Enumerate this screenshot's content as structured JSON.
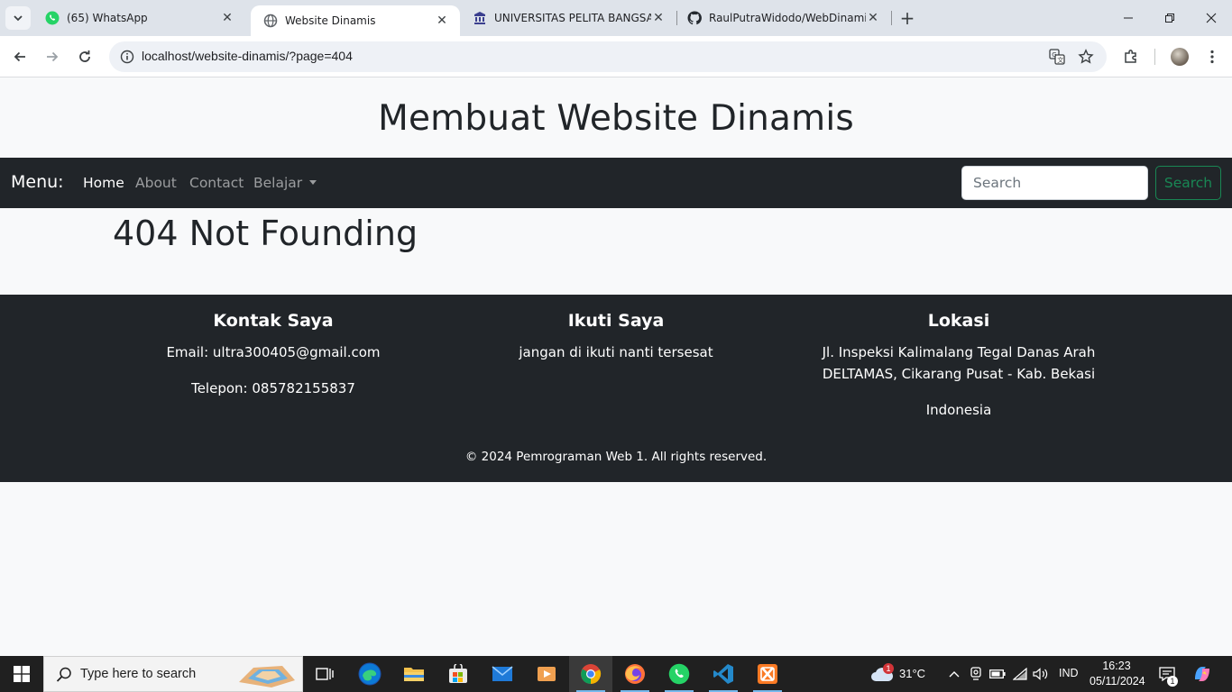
{
  "browser": {
    "tabs": [
      {
        "title": "(65) WhatsApp",
        "favicon": "whatsapp-icon"
      },
      {
        "title": "Website Dinamis",
        "favicon": "globe-icon",
        "active": true
      },
      {
        "title": "UNIVERSITAS PELITA BANGSA",
        "favicon": "university-icon"
      },
      {
        "title": "RaulPutraWidodo/WebDinamis",
        "favicon": "github-icon"
      }
    ],
    "url": "localhost/website-dinamis/?page=404"
  },
  "site": {
    "title": "Membuat Website Dinamis",
    "nav": {
      "brand": "Menu:",
      "links": [
        "Home",
        "About",
        "Contact",
        "Belajar"
      ],
      "search_placeholder": "Search",
      "search_button": "Search"
    },
    "content": {
      "heading": "404 Not Founding"
    },
    "footer": {
      "contact": {
        "heading": "Kontak Saya",
        "email": "Email: ultra300405@gmail.com",
        "phone": "Telepon: 085782155837"
      },
      "follow": {
        "heading": "Ikuti Saya",
        "text": "jangan di ikuti nanti tersesat"
      },
      "location": {
        "heading": "Lokasi",
        "address_line1": "Jl. Inspeksi Kalimalang Tegal Danas Arah",
        "address_line2": "DELTAMAS, Cikarang Pusat - Kab. Bekasi",
        "country": "Indonesia"
      },
      "copyright": "© 2024 Pemrograman Web 1. All rights reserved."
    }
  },
  "taskbar": {
    "search_placeholder": "Type here to search",
    "weather_temp": "31°C",
    "weather_badge": "1",
    "language": "IND",
    "time": "16:23",
    "date": "05/11/2024",
    "notification_count": "1"
  },
  "colors": {
    "navbar_bg": "#212529",
    "page_bg": "#f8f9fa",
    "search_button": "#198754",
    "chrome_tabbar": "#dee3ea"
  }
}
